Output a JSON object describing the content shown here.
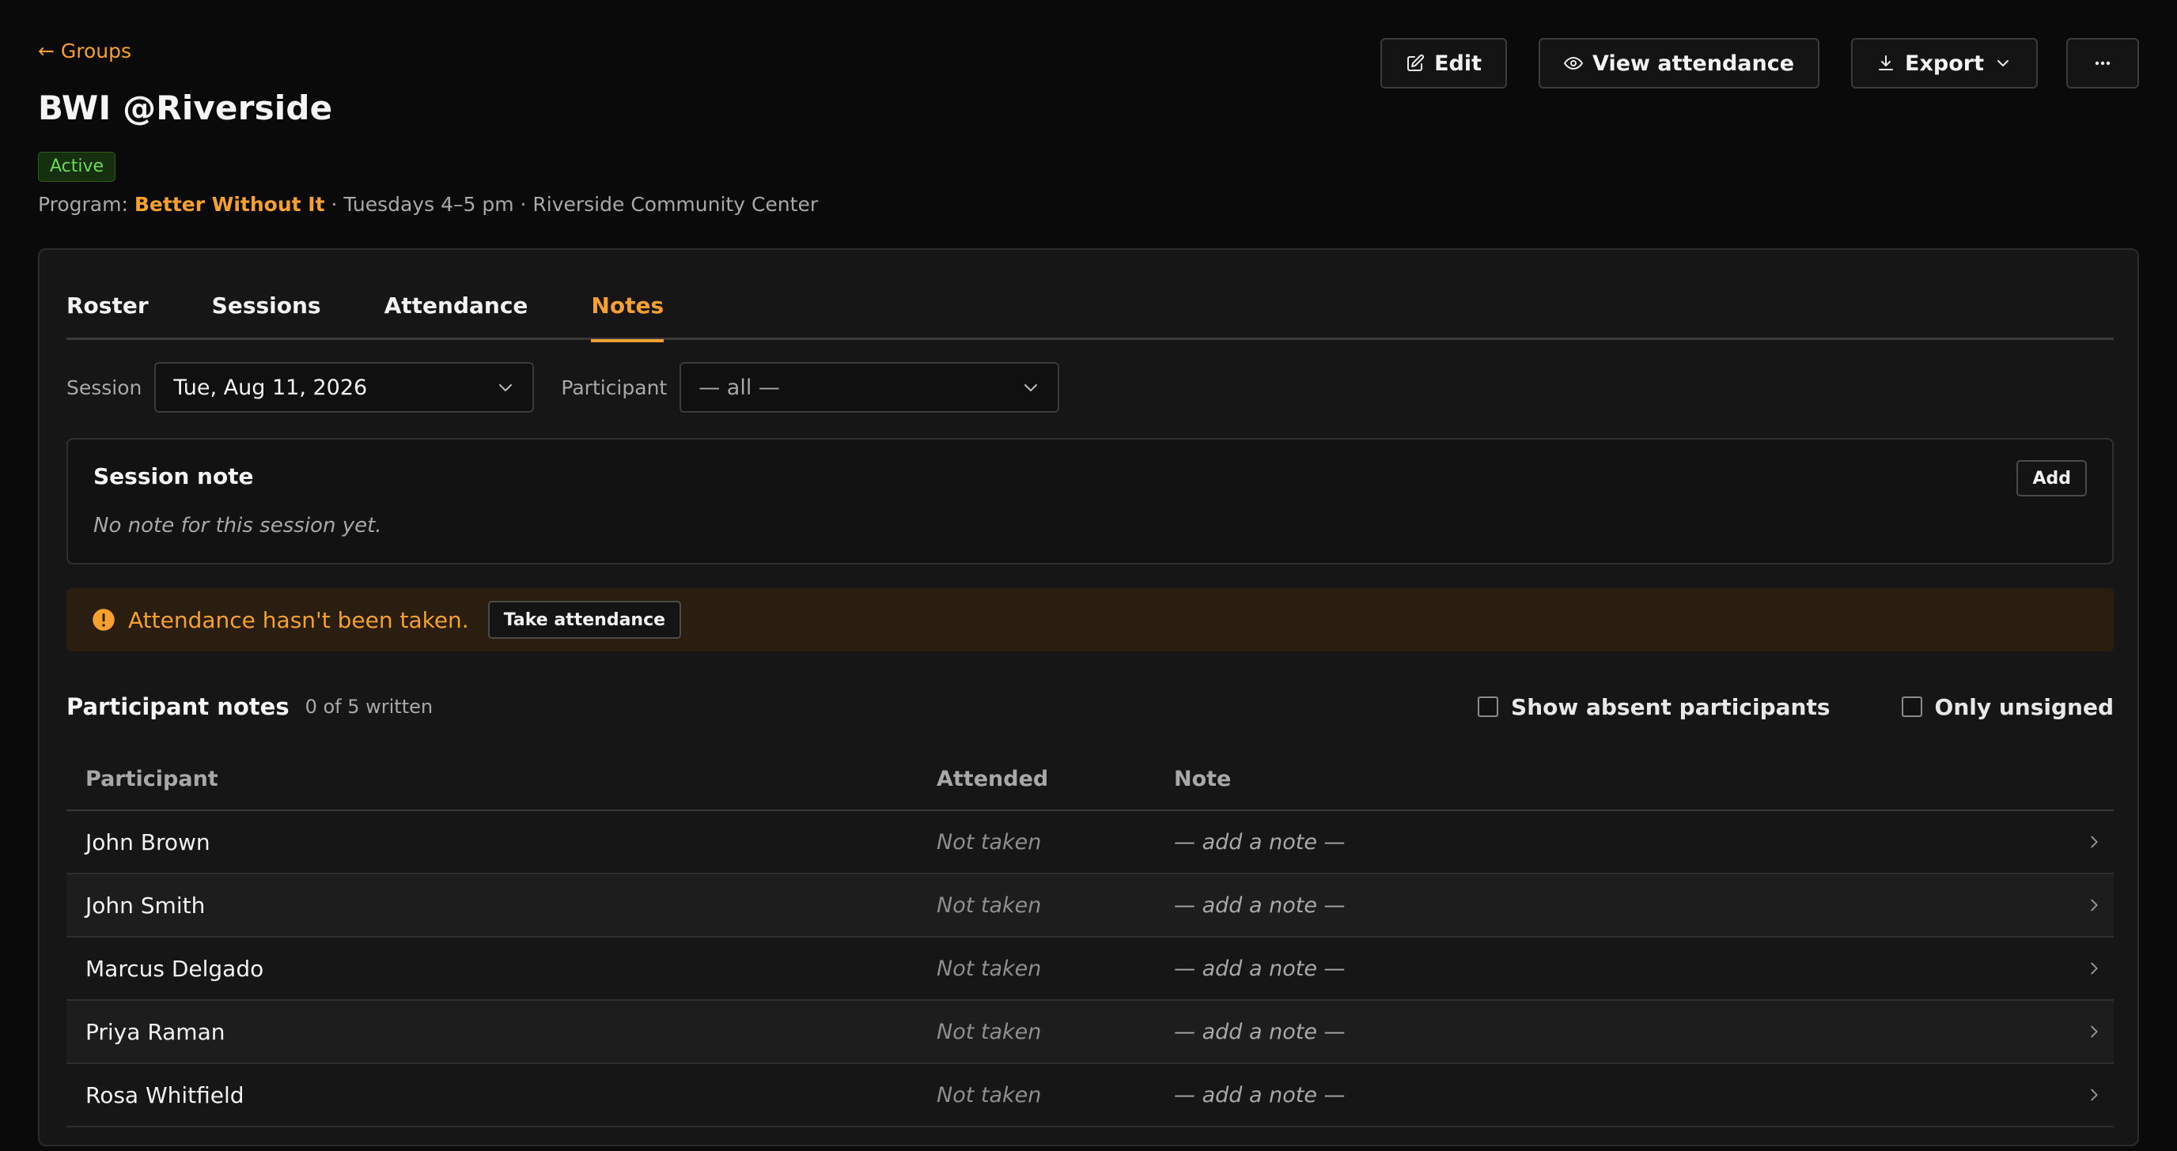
{
  "header": {
    "back_label": "← Groups",
    "title": "BWI @Riverside",
    "status": "Active",
    "meta_prefix": "Program: ",
    "program_name": "Better Without It",
    "meta_suffix": " · Tuesdays 4–5 pm · Riverside Community Center"
  },
  "actions": {
    "edit": "Edit",
    "view_attendance": "View attendance",
    "export": "Export"
  },
  "tabs": [
    {
      "label": "Roster",
      "active": false
    },
    {
      "label": "Sessions",
      "active": false
    },
    {
      "label": "Attendance",
      "active": false
    },
    {
      "label": "Notes",
      "active": true
    }
  ],
  "filters": {
    "session_label": "Session",
    "session_value": "Tue, Aug 11, 2026",
    "participant_label": "Participant",
    "participant_value": "— all —"
  },
  "session_note": {
    "title": "Session note",
    "empty": "No note for this session yet.",
    "add_label": "Add"
  },
  "alert": {
    "text": "Attendance hasn't been taken.",
    "action": "Take attendance"
  },
  "participant_notes": {
    "title": "Participant notes",
    "count": "0 of 5 written",
    "show_absent": "Show absent participants",
    "only_unsigned": "Only unsigned",
    "columns": {
      "participant": "Participant",
      "attended": "Attended",
      "note": "Note"
    },
    "rows": [
      {
        "name": "John Brown",
        "attended": "Not taken",
        "note": "— add a note —"
      },
      {
        "name": "John Smith",
        "attended": "Not taken",
        "note": "— add a note —"
      },
      {
        "name": "Marcus Delgado",
        "attended": "Not taken",
        "note": "— add a note —"
      },
      {
        "name": "Priya Raman",
        "attended": "Not taken",
        "note": "— add a note —"
      },
      {
        "name": "Rosa Whitfield",
        "attended": "Not taken",
        "note": "— add a note —"
      }
    ]
  },
  "colors": {
    "accent": "#f5a031",
    "background": "#0a0a0a",
    "card": "#161616",
    "success": "#6fd65a"
  },
  "icons": {
    "edit": "edit-icon",
    "view": "eye-icon",
    "export": "download-icon",
    "more": "more-horizontal-icon",
    "alert": "exclamation-circle-icon",
    "row": "chevron-right-icon"
  }
}
